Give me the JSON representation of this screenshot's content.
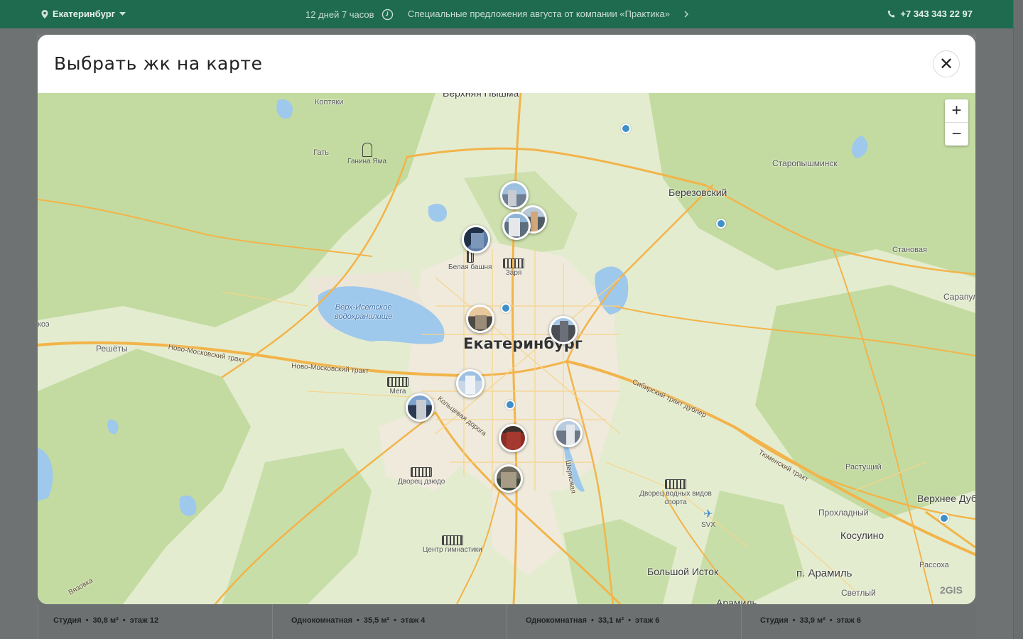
{
  "topbar": {
    "city": "Екатеринбург",
    "countdown": "12 дней 7 часов",
    "promo": "Специальные предложения августа от компании «Практика»",
    "phone": "+7 343 343 22 97"
  },
  "modal": {
    "title": "Выбрать жк на карте",
    "close_icon": "close-icon"
  },
  "map": {
    "zoom_in": "+",
    "zoom_out": "−",
    "attribution": "2GIS",
    "city_label": "Екатеринбург",
    "towns": [
      "Верхняя Пышма",
      "Березовский",
      "Старопышминск",
      "Коптяки",
      "Гать",
      "Ганина Яма",
      "Становая",
      "Сарапул",
      "Решёты",
      "Растущий",
      "Прохладный",
      "Косулино",
      "Верхнее Дуб",
      "п. Арамиль",
      "Рассоха",
      "Светлый",
      "Большой Исток",
      "Арамиль",
      "коэ"
    ],
    "water": [
      "Верх-Исетское",
      "водохранилище"
    ],
    "roads": [
      "Ново-Московский тракт",
      "Ново-Московский тракт",
      "Сибирский тракт дублер",
      "Тюменский тракт",
      "Шерновая",
      "Кольцевая дорога",
      "Вязовка"
    ],
    "pois": [
      "Белая башня",
      "Заря",
      "Мега",
      "Дворец дзюдо",
      "Центр гимнастики",
      "Дворец водных видов спорта",
      "SVX"
    ],
    "pins_count": 12
  },
  "cards": [
    {
      "type": "Студия",
      "area": "30,8 м²",
      "floor": "этаж 12"
    },
    {
      "type": "Однокомнатная",
      "area": "35,5 м²",
      "floor": "этаж 4"
    },
    {
      "type": "Однокомнатная",
      "area": "33,1 м²",
      "floor": "этаж 6"
    },
    {
      "type": "Студия",
      "area": "33,9 м²",
      "floor": "этаж 6"
    }
  ],
  "colors": {
    "topbar_bg": "#1e6b4f",
    "map_forest": "#bfd89a",
    "map_road": "#f2b44a",
    "map_water": "#9ec8ec"
  }
}
